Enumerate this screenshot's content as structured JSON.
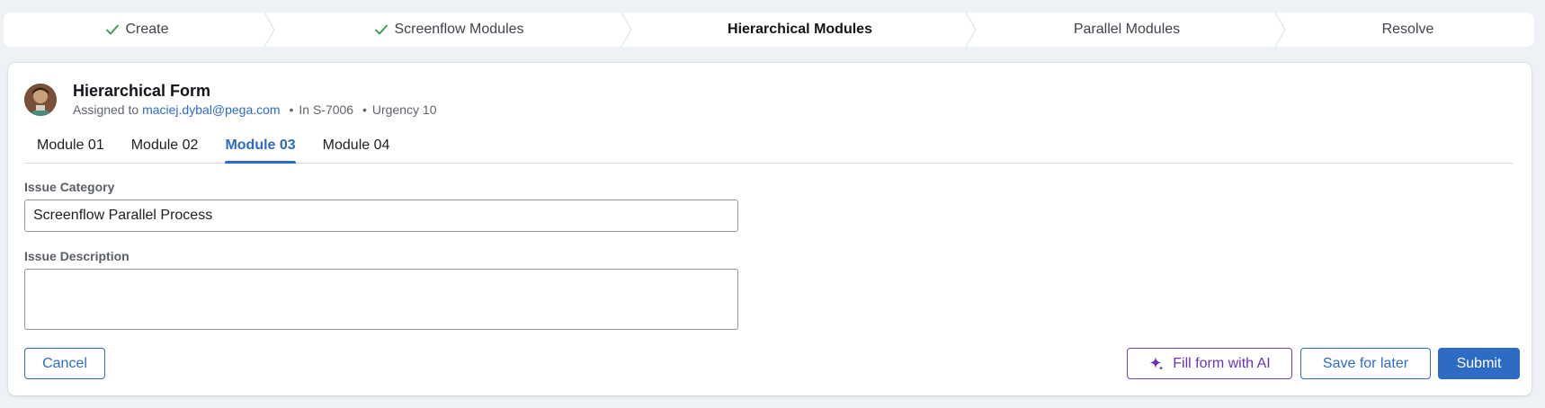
{
  "stepper": {
    "steps": [
      {
        "label": "Create",
        "status": "completed"
      },
      {
        "label": "Screenflow Modules",
        "status": "completed"
      },
      {
        "label": "Hierarchical Modules",
        "status": "current"
      },
      {
        "label": "Parallel Modules",
        "status": "upcoming"
      },
      {
        "label": "Resolve",
        "status": "upcoming"
      }
    ]
  },
  "header": {
    "title": "Hierarchical Form",
    "assigned_prefix": "Assigned to",
    "assignee": "maciej.dybal@pega.com",
    "separator": "•",
    "case_ref": "In S-7006",
    "urgency": "Urgency 10"
  },
  "tabs": [
    {
      "label": "Module 01",
      "active": false
    },
    {
      "label": "Module 02",
      "active": false
    },
    {
      "label": "Module 03",
      "active": true
    },
    {
      "label": "Module 04",
      "active": false
    }
  ],
  "form": {
    "issue_category": {
      "label": "Issue Category",
      "value": "Screenflow Parallel Process"
    },
    "issue_description": {
      "label": "Issue Description",
      "value": ""
    }
  },
  "actions": {
    "cancel_label": "Cancel",
    "ai_label": "Fill form with AI",
    "save_label": "Save for later",
    "submit_label": "Submit"
  },
  "colors": {
    "accent": "#2e6bc5",
    "ai_accent": "#6a32b8",
    "check": "#2e9e4a",
    "background": "#eef1f5"
  },
  "icons": {
    "step_completed": "check-icon",
    "ai_button": "sparkle-icon",
    "step_separator": "chevron-right-icon"
  }
}
